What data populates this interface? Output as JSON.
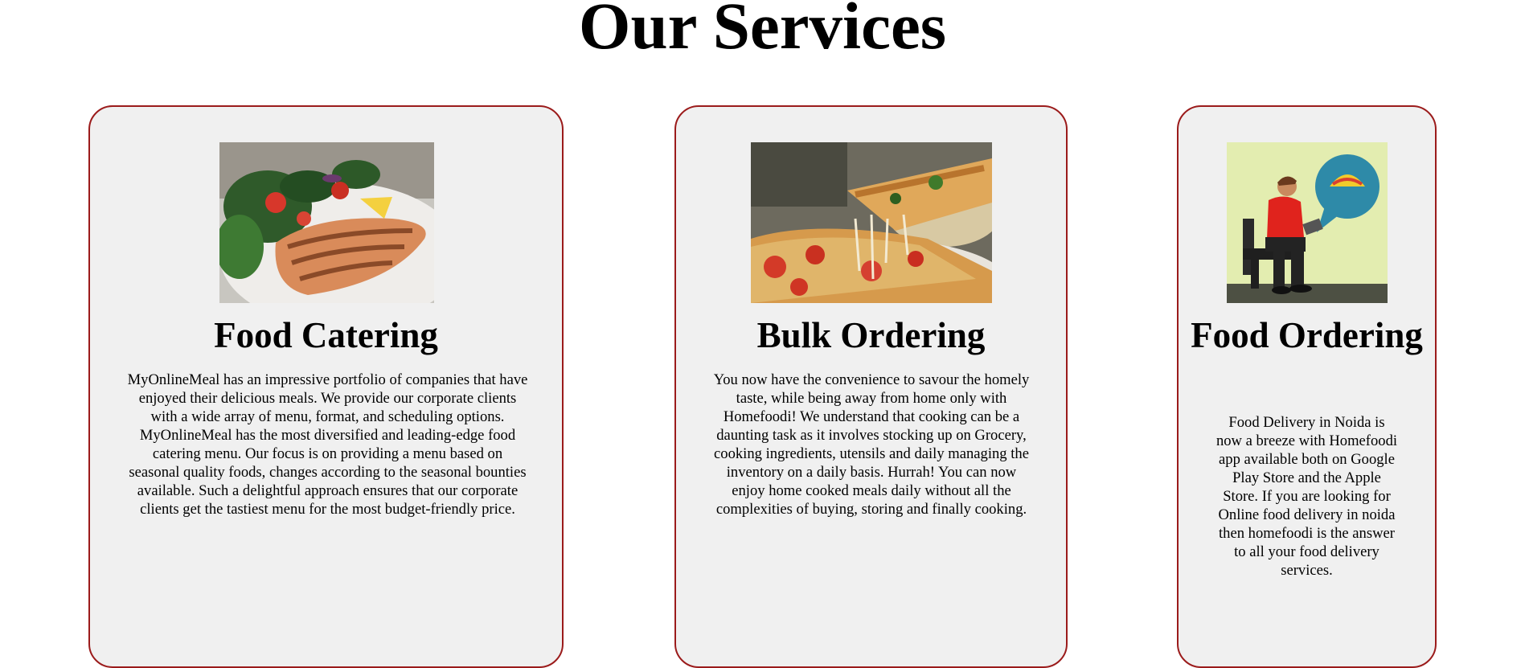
{
  "page": {
    "title": "Our Services"
  },
  "colors": {
    "card_background": "#f0f0f0",
    "card_border": "#9b1b1b"
  },
  "services": [
    {
      "title": "Food Catering",
      "image_icon": "salmon-salad-photo",
      "description": "MyOnlineMeal has an impressive portfolio of companies that have enjoyed their delicious meals. We provide our corporate clients with a wide array of menu, format, and scheduling options. MyOnlineMeal has the most diversified and leading-edge food catering menu. Our focus is on providing a menu based on seasonal quality foods, changes according to the seasonal bounties available. Such a delightful approach ensures that our corporate clients get the tastiest menu for the most budget-friendly price."
    },
    {
      "title": "Bulk Ordering",
      "image_icon": "pizza-photo",
      "description": "You now have the convenience to savour the homely taste, while being away from home only with Homefoodi! We understand that cooking can be a daunting task as it involves stocking up on Grocery, cooking ingredients, utensils and daily managing the inventory on a daily basis. Hurrah! You can now enjoy home cooked meals daily without all the complexities of buying, storing and finally cooking."
    },
    {
      "title": "Food Ordering",
      "image_icon": "person-ordering-food-illustration",
      "description": "Food Delivery in Noida is now a breeze with Homefoodi app available both on Google Play Store and the Apple Store. If you are looking for Online food delivery in noida then homefoodi is the answer to all your food delivery services."
    }
  ]
}
